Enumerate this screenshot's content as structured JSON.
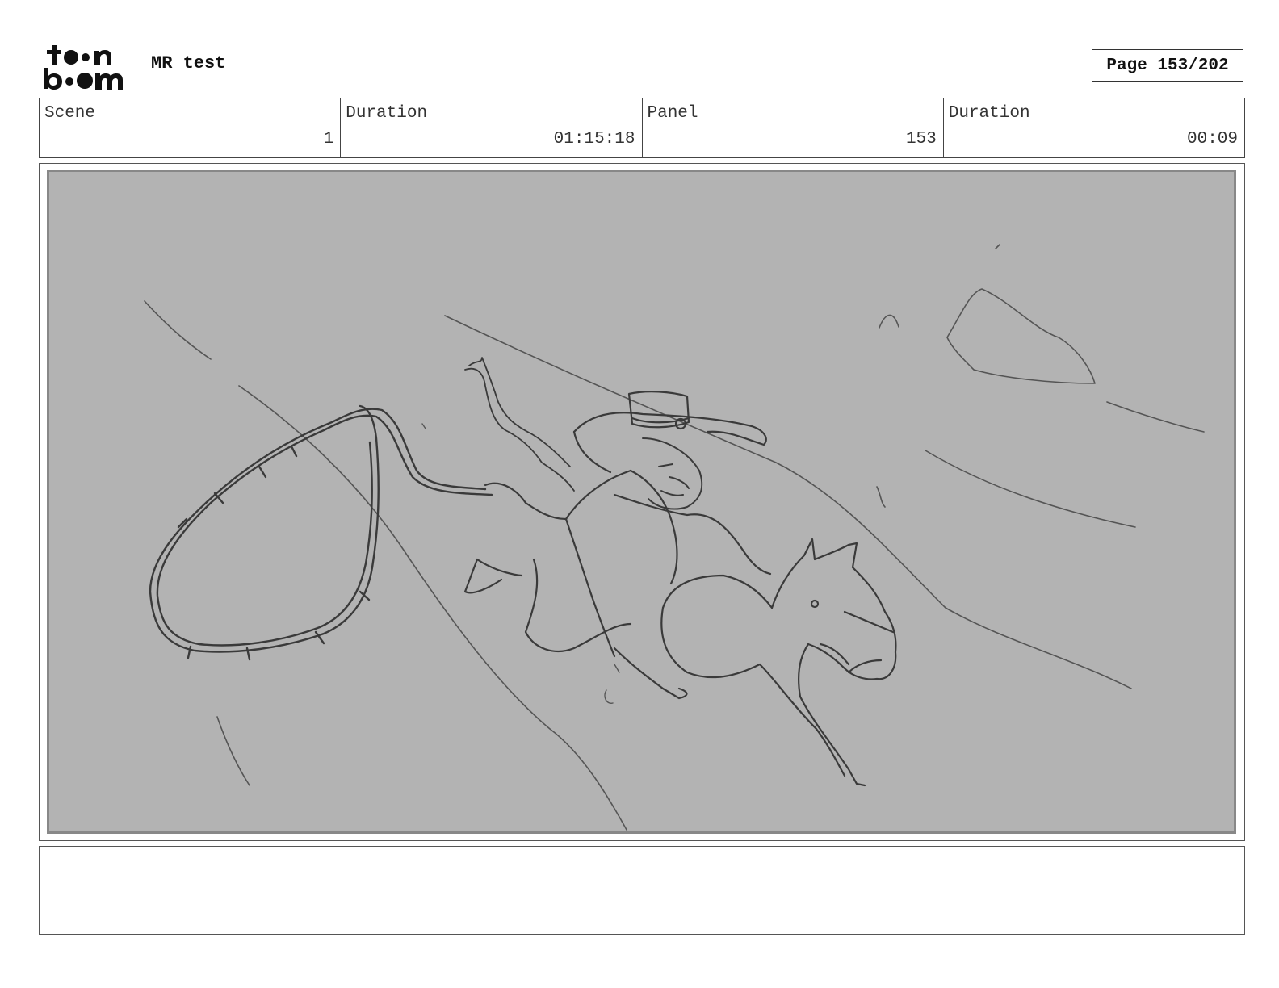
{
  "header": {
    "logo_text": "toon boom",
    "project_title": "MR test",
    "page_label": "Page 153/202"
  },
  "info_row": [
    {
      "label": "Scene",
      "value": "1"
    },
    {
      "label": "Duration",
      "value": "01:15:18"
    },
    {
      "label": "Panel",
      "value": "153"
    },
    {
      "label": "Duration",
      "value": "00:09"
    }
  ],
  "panel": {
    "image_subject": "rough-sketch-cowgirl-on-horse-with-lasso"
  },
  "notes": {
    "text": ""
  },
  "colors": {
    "panel_background": "#b3b3b3",
    "sketch_line": "#3a3a3a",
    "border": "#444444"
  }
}
